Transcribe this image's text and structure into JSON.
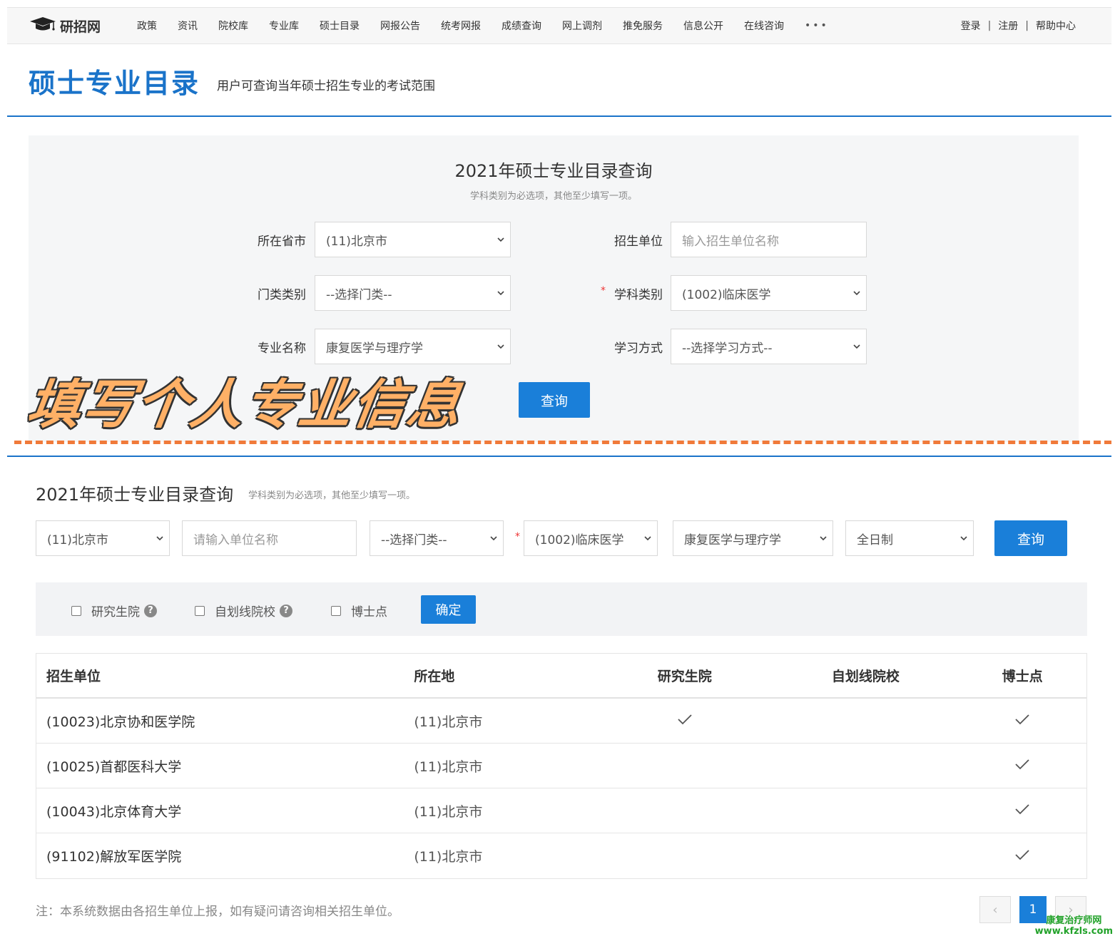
{
  "nav": {
    "logo_text": "研招网",
    "items": [
      "政策",
      "资讯",
      "院校库",
      "专业库",
      "硕士目录",
      "网报公告",
      "统考网报",
      "成绩查询",
      "网上调剂",
      "推免服务",
      "信息公开",
      "在线咨询"
    ],
    "more": "•••",
    "right": {
      "login": "登录",
      "register": "注册",
      "help": "帮助中心",
      "separator": "|"
    }
  },
  "header": {
    "title": "硕士专业目录",
    "subtitle": "用户可查询当年硕士招生专业的考试范围"
  },
  "query_panel": {
    "title": "2021年硕士专业目录查询",
    "hint": "学科类别为必选项，其他至少填写一项。",
    "fields": {
      "province": {
        "label": "所在省市",
        "value": "(11)北京市"
      },
      "unit": {
        "label": "招生单位",
        "placeholder": "输入招生单位名称"
      },
      "category": {
        "label": "门类类别",
        "value": "--选择门类--"
      },
      "discipline": {
        "label": "学科类别",
        "value": "(1002)临床医学",
        "required_mark": "*"
      },
      "major": {
        "label": "专业名称",
        "value": "康复医学与理疗学"
      },
      "study_mode": {
        "label": "学习方式",
        "value": "--选择学习方式--"
      }
    },
    "search_button": "查询",
    "banner": "填写个人专业信息"
  },
  "results": {
    "title": "2021年硕士专业目录查询",
    "hint": "学科类别为必选项，其他至少填写一项。",
    "filters": {
      "province": "(11)北京市",
      "unit_placeholder": "请输入单位名称",
      "category": "--选择门类--",
      "required_mark": "*",
      "discipline": "(1002)临床医学",
      "major": "康复医学与理疗学",
      "study_mode": "全日制",
      "search_button": "查询"
    },
    "checkboxes": {
      "graduate_school": "研究生院",
      "self_line": "自划线院校",
      "doctoral": "博士点",
      "help_icon": "?",
      "confirm_button": "确定"
    },
    "table": {
      "headers": [
        "招生单位",
        "所在地",
        "研究生院",
        "自划线院校",
        "博士点"
      ],
      "rows": [
        {
          "unit": "(10023)北京协和医学院",
          "location": "(11)北京市",
          "graduate_school": true,
          "self_line": false,
          "doctoral": true
        },
        {
          "unit": "(10025)首都医科大学",
          "location": "(11)北京市",
          "graduate_school": false,
          "self_line": false,
          "doctoral": true
        },
        {
          "unit": "(10043)北京体育大学",
          "location": "(11)北京市",
          "graduate_school": false,
          "self_line": false,
          "doctoral": true
        },
        {
          "unit": "(91102)解放军医学院",
          "location": "(11)北京市",
          "graduate_school": false,
          "self_line": false,
          "doctoral": true
        }
      ]
    },
    "note": "注：本系统数据由各招生单位上报，如有疑问请咨询相关招生单位。",
    "pagination": {
      "prev": "‹",
      "current": "1",
      "next": "›"
    }
  },
  "watermark": {
    "line1": "康复治疗师网",
    "line2": "www.kfzls.com"
  },
  "colors": {
    "brand_blue": "#1a73c9",
    "button_blue": "#1a7fd9",
    "dash_orange": "#f07a3a",
    "banner_orange": "#ffb066",
    "watermark_green": "#22a22a"
  },
  "icons": {
    "logo": "graduation-cap-icon",
    "select": "chevron-down-icon",
    "check": "checkmark-icon",
    "help": "question-circle-icon"
  }
}
